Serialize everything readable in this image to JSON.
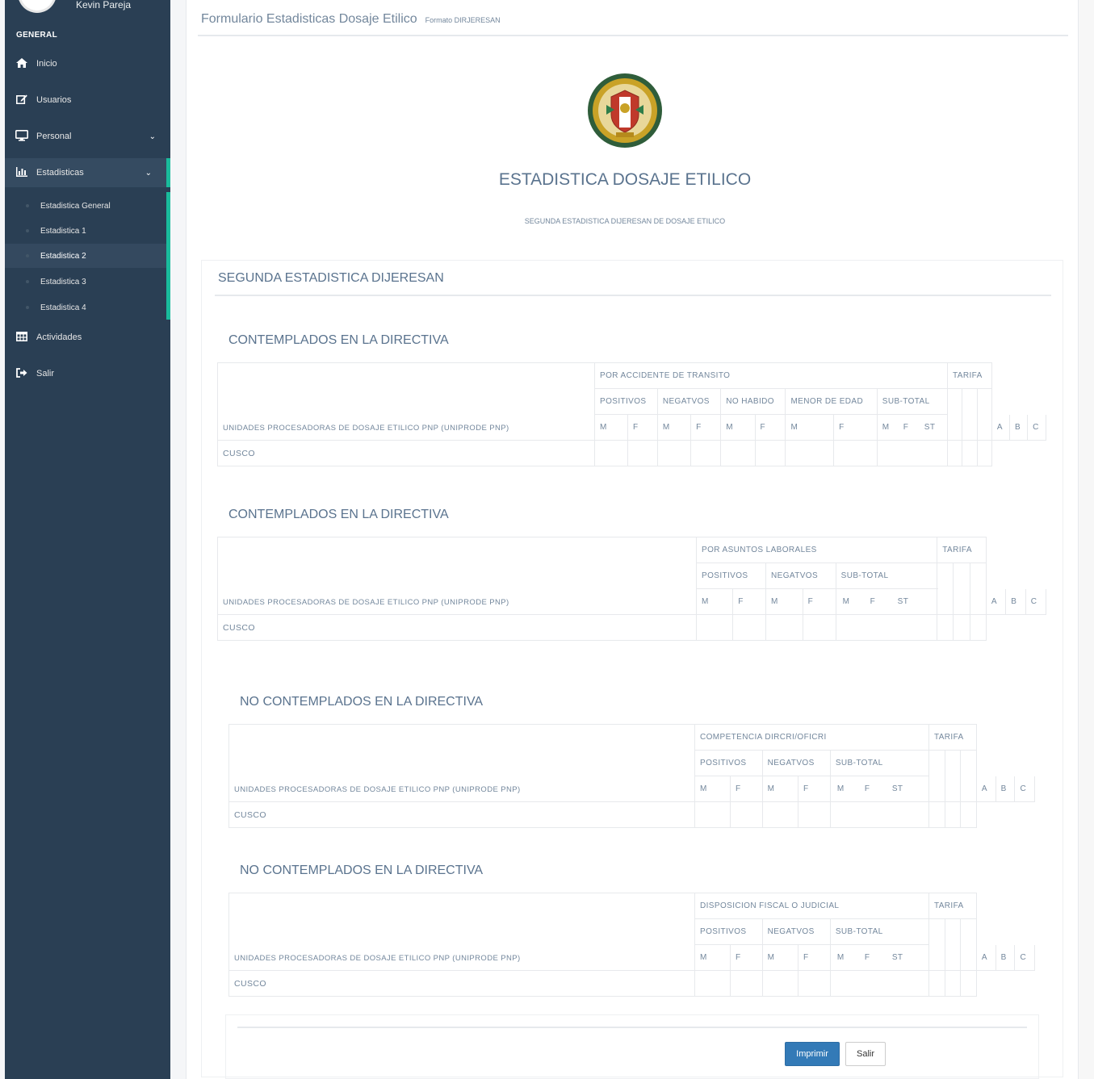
{
  "sidebar": {
    "user_name": "Kevin Pareja",
    "section_title": "GENERAL",
    "items": [
      {
        "label": "Inicio",
        "icon": "home-icon"
      },
      {
        "label": "Usuarios",
        "icon": "edit-icon"
      },
      {
        "label": "Personal",
        "icon": "desktop-icon"
      },
      {
        "label": "Estadisticas",
        "icon": "bar-chart-icon"
      },
      {
        "label": "Actividades",
        "icon": "table-icon"
      },
      {
        "label": "Salir",
        "icon": "sign-out-icon"
      }
    ],
    "submenu": [
      {
        "label": "Estadistica General"
      },
      {
        "label": "Estadistica 1"
      },
      {
        "label": "Estadistica 2"
      },
      {
        "label": "Estadistica 3"
      },
      {
        "label": "Estadistica 4"
      }
    ],
    "accent_color": "#1abb9c",
    "background_color": "#2a3f54"
  },
  "header": {
    "title": "Formulario Estadisticas Dosaje Etilico",
    "subtitle": "Formato DIRJERESAN"
  },
  "report": {
    "heading": "ESTADISTICA DOSAJE ETILICO",
    "subheading": "SEGUNDA ESTADISTICA DIJERESAN DE DOSAJE ETILICO",
    "panel_title": "SEGUNDA ESTADISTICA DIJERESAN"
  },
  "tables": [
    {
      "section_title": "CONTEMPLADOS EN LA DIRECTIVA",
      "group": "POR ACCIDENTE DE TRANSITO",
      "tarifa": "TARIFA",
      "subgroups": [
        "POSITIVOS",
        "NEGATVOS",
        "NO HABIDO",
        "MENOR DE EDAD",
        "SUB-TOTAL"
      ],
      "units_header": "UNIDADES PROCESADORAS DE DOSAJE ETILICO PNP (UNIPRODE PNP)",
      "cols": [
        "M",
        "F",
        "M",
        "F",
        "M",
        "F",
        "M",
        "F",
        "M",
        "F",
        "ST",
        "A",
        "B",
        "C"
      ],
      "row": "CUSCO"
    },
    {
      "section_title": "CONTEMPLADOS EN LA DIRECTIVA",
      "group": "POR ASUNTOS LABORALES",
      "tarifa": "TARIFA",
      "subgroups": [
        "POSITIVOS",
        "NEGATVOS",
        "SUB-TOTAL"
      ],
      "units_header": "UNIDADES PROCESADORAS DE DOSAJE ETILICO PNP (UNIPRODE PNP)",
      "cols": [
        "M",
        "F",
        "M",
        "F",
        "M",
        "F",
        "ST",
        "A",
        "B",
        "C"
      ],
      "row": "CUSCO"
    },
    {
      "section_title": "NO CONTEMPLADOS EN LA DIRECTIVA",
      "group": "COMPETENCIA DIRCRI/OFICRI",
      "tarifa": "TARIFA",
      "subgroups": [
        "POSITIVOS",
        "NEGATVOS",
        "SUB-TOTAL"
      ],
      "units_header": "UNIDADES PROCESADORAS DE DOSAJE ETILICO PNP (UNIPRODE PNP)",
      "cols": [
        "M",
        "F",
        "M",
        "F",
        "M",
        "F",
        "ST",
        "A",
        "B",
        "C"
      ],
      "row": "CUSCO"
    },
    {
      "section_title": "NO CONTEMPLADOS EN LA DIRECTIVA",
      "group": "DISPOSICION FISCAL O JUDICIAL",
      "tarifa": "TARIFA",
      "subgroups": [
        "POSITIVOS",
        "NEGATVOS",
        "SUB-TOTAL"
      ],
      "units_header": "UNIDADES PROCESADORAS DE DOSAJE ETILICO PNP (UNIPRODE PNP)",
      "cols": [
        "M",
        "F",
        "M",
        "F",
        "M",
        "F",
        "ST",
        "A",
        "B",
        "C"
      ],
      "row": "CUSCO"
    }
  ],
  "buttons": {
    "print": "Imprimir",
    "exit": "Salir",
    "primary_color": "#337ab7"
  }
}
